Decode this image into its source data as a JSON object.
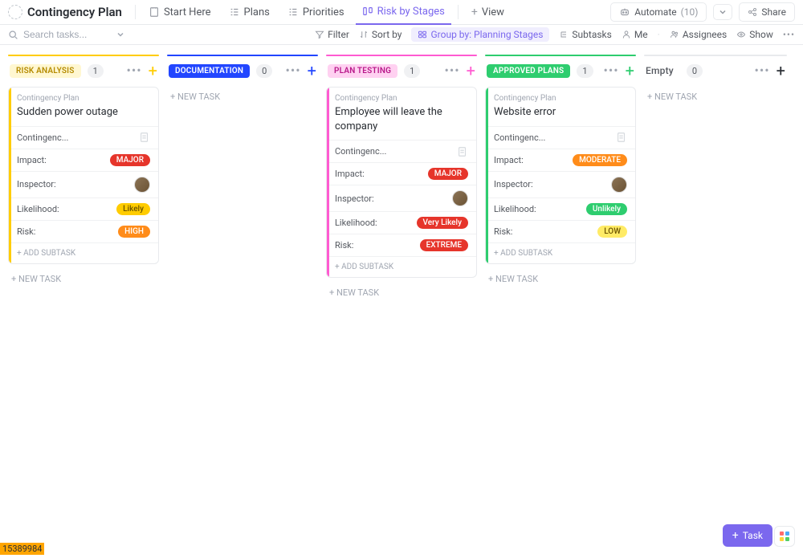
{
  "header": {
    "title": "Contingency Plan",
    "tabs": [
      {
        "label": "Start Here"
      },
      {
        "label": "Plans"
      },
      {
        "label": "Priorities"
      },
      {
        "label": "Risk by Stages"
      },
      {
        "label": "View"
      }
    ],
    "automate_label": "Automate",
    "automate_count": "(10)",
    "share_label": "Share"
  },
  "toolbar": {
    "search_placeholder": "Search tasks...",
    "filter": "Filter",
    "sortby": "Sort by",
    "groupby": "Group by: Planning Stages",
    "subtasks": "Subtasks",
    "me": "Me",
    "assignees": "Assignees",
    "show": "Show"
  },
  "columns": [
    {
      "label": "RISK ANALYSIS",
      "count": "1",
      "color_top": "#ffcc00",
      "color_bg": "#fff7d1",
      "color_text": "#b58b00",
      "plus_color": "#ffcc00",
      "card": {
        "border_color": "#ffcc00",
        "breadcrumb": "Contingency Plan",
        "title": "Sudden power outage",
        "contingenc_label": "Contingenc...",
        "impact_label": "Impact:",
        "impact_badge": "MAJOR",
        "impact_bg": "#e6352b",
        "inspector_label": "Inspector:",
        "likelihood_label": "Likelihood:",
        "likelihood_badge": "Likely",
        "likelihood_bg": "#ffcc00",
        "likelihood_text": "#6b5300",
        "risk_label": "Risk:",
        "risk_badge": "HIGH",
        "risk_bg": "#ff8c1a",
        "add_subtask": "+ ADD SUBTASK"
      },
      "new_task": "+ NEW TASK"
    },
    {
      "label": "DOCUMENTATION",
      "count": "0",
      "color_top": "#2246ff",
      "color_bg": "#2246ff",
      "color_text": "#ffffff",
      "plus_color": "#2246ff",
      "new_task": "+ NEW TASK"
    },
    {
      "label": "PLAN TESTING",
      "count": "1",
      "color_top": "#ff5bd1",
      "color_bg": "#ffd1f1",
      "color_text": "#b8188a",
      "plus_color": "#ff5bd1",
      "card": {
        "border_color": "#ff5bd1",
        "breadcrumb": "Contingency Plan",
        "title": "Employee will leave the company",
        "contingenc_label": "Contingenc...",
        "impact_label": "Impact:",
        "impact_badge": "MAJOR",
        "impact_bg": "#e6352b",
        "inspector_label": "Inspector:",
        "likelihood_label": "Likelihood:",
        "likelihood_badge": "Very Likely",
        "likelihood_bg": "#e6352b",
        "likelihood_text": "#ffffff",
        "risk_label": "Risk:",
        "risk_badge": "EXTREME",
        "risk_bg": "#e6352b",
        "add_subtask": "+ ADD SUBTASK"
      },
      "new_task": "+ NEW TASK"
    },
    {
      "label": "APPROVED PLANS",
      "count": "1",
      "color_top": "#2ecd6f",
      "color_bg": "#2ecd6f",
      "color_text": "#ffffff",
      "plus_color": "#2ecd6f",
      "card": {
        "border_color": "#2ecd6f",
        "breadcrumb": "Contingency Plan",
        "title": "Website error",
        "contingenc_label": "Contingenc...",
        "impact_label": "Impact:",
        "impact_badge": "MODERATE",
        "impact_bg": "#ff8c1a",
        "inspector_label": "Inspector:",
        "likelihood_label": "Likelihood:",
        "likelihood_badge": "Unlikely",
        "likelihood_bg": "#2ecd6f",
        "likelihood_text": "#ffffff",
        "risk_label": "Risk:",
        "risk_badge": "LOW",
        "risk_bg": "#ffeb66",
        "risk_text": "#6b5300",
        "add_subtask": "+ ADD SUBTASK"
      },
      "new_task": "+ NEW TASK"
    },
    {
      "label": "Empty",
      "count": "0",
      "empty": true,
      "new_task": "+ NEW TASK"
    }
  ],
  "footer": {
    "file_id": "15389984",
    "task_btn": "Task"
  }
}
